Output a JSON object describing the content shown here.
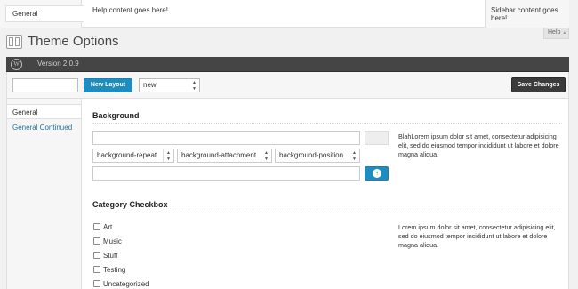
{
  "help": {
    "tab_label": "General",
    "content": "Help content goes here!",
    "sidebar": "Sidebar content goes here!",
    "toggle_label": "Help",
    "toggle_arrow": "▲"
  },
  "page": {
    "title": "Theme Options",
    "icon": "layout-icon"
  },
  "version_bar": {
    "logo": "W",
    "version": "Version 2.0.9"
  },
  "toolbar": {
    "layout_name_value": "",
    "new_layout_label": "New Layout",
    "layout_select_value": "new",
    "save_label": "Save Changes"
  },
  "nav": {
    "items": [
      {
        "label": "General"
      },
      {
        "label": "General Continued"
      }
    ]
  },
  "background_section": {
    "heading": "Background",
    "repeat_select": "background-repeat",
    "attachment_select": "background-attachment",
    "position_select": "background-position",
    "description": "BlahLorem ipsum dolor sit amet, consectetur adipisicing elit, sed do eiusmod tempor incididunt ut labore et dolore magna aliqua."
  },
  "category_section": {
    "heading": "Category Checkbox",
    "description": "Lorem ipsum dolor sit amet, consectetur adipisicing elit, sed do eiusmod tempor incididunt ut labore et dolore magna aliqua.",
    "options": [
      "Art",
      "Music",
      "Stuff",
      "Testing",
      "Uncategorized"
    ]
  },
  "colors": {
    "accent": "#1e8cbe",
    "dark_bar": "#454545",
    "save_button": "#3b3b3b",
    "link": "#21759b"
  }
}
